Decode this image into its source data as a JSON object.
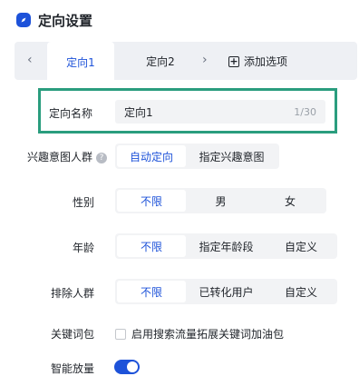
{
  "header": {
    "title": "定向设置",
    "logo_icon": "compass-icon"
  },
  "tabs": {
    "prev_icon": "‹",
    "items": [
      {
        "label": "定向1",
        "active": true
      },
      {
        "label": "定向2",
        "active": false
      }
    ],
    "next_icon": "›",
    "add_label": "添加选项"
  },
  "name_field": {
    "label": "定向名称",
    "value": "定向1",
    "count": "1/30"
  },
  "interest": {
    "label": "兴趣意图人群",
    "options": [
      "自动定向",
      "指定兴趣意图"
    ],
    "selected": 0
  },
  "gender": {
    "label": "性别",
    "options": [
      "不限",
      "男",
      "女"
    ],
    "selected": 0
  },
  "age": {
    "label": "年龄",
    "options": [
      "不限",
      "指定年龄段",
      "自定义"
    ],
    "selected": 0
  },
  "exclude": {
    "label": "排除人群",
    "options": [
      "不限",
      "已转化用户",
      "自定义"
    ],
    "selected": 0
  },
  "keywords": {
    "label": "关键词包",
    "checkbox_label": "启用搜索流量拓展关键词加油包",
    "checked": false
  },
  "smart": {
    "label": "智能放量",
    "enabled": true
  },
  "colors": {
    "accent": "#1d52d9",
    "highlight": "#2a9d7e"
  }
}
